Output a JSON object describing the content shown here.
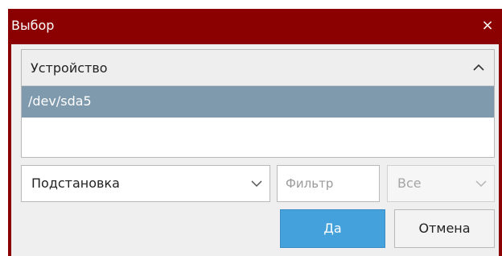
{
  "dialog": {
    "title": "Выбор",
    "close_glyph": "×"
  },
  "list": {
    "column_header": "Устройство",
    "sort_icon": "chevron-up-icon",
    "rows": [
      {
        "label": "/dev/sda5",
        "selected": true
      }
    ]
  },
  "substitution_select": {
    "value": "Подстановка",
    "icon": "chevron-down-icon"
  },
  "filter_input": {
    "value": "",
    "placeholder": "Фильтр"
  },
  "scope_select": {
    "value": "Все",
    "disabled": true,
    "icon": "chevron-down-icon"
  },
  "buttons": {
    "ok_label": "Да",
    "cancel_label": "Отмена"
  },
  "colors": {
    "titlebar": "#8b0000",
    "selection": "#7f99ad",
    "primary_button": "#44a1dc"
  }
}
